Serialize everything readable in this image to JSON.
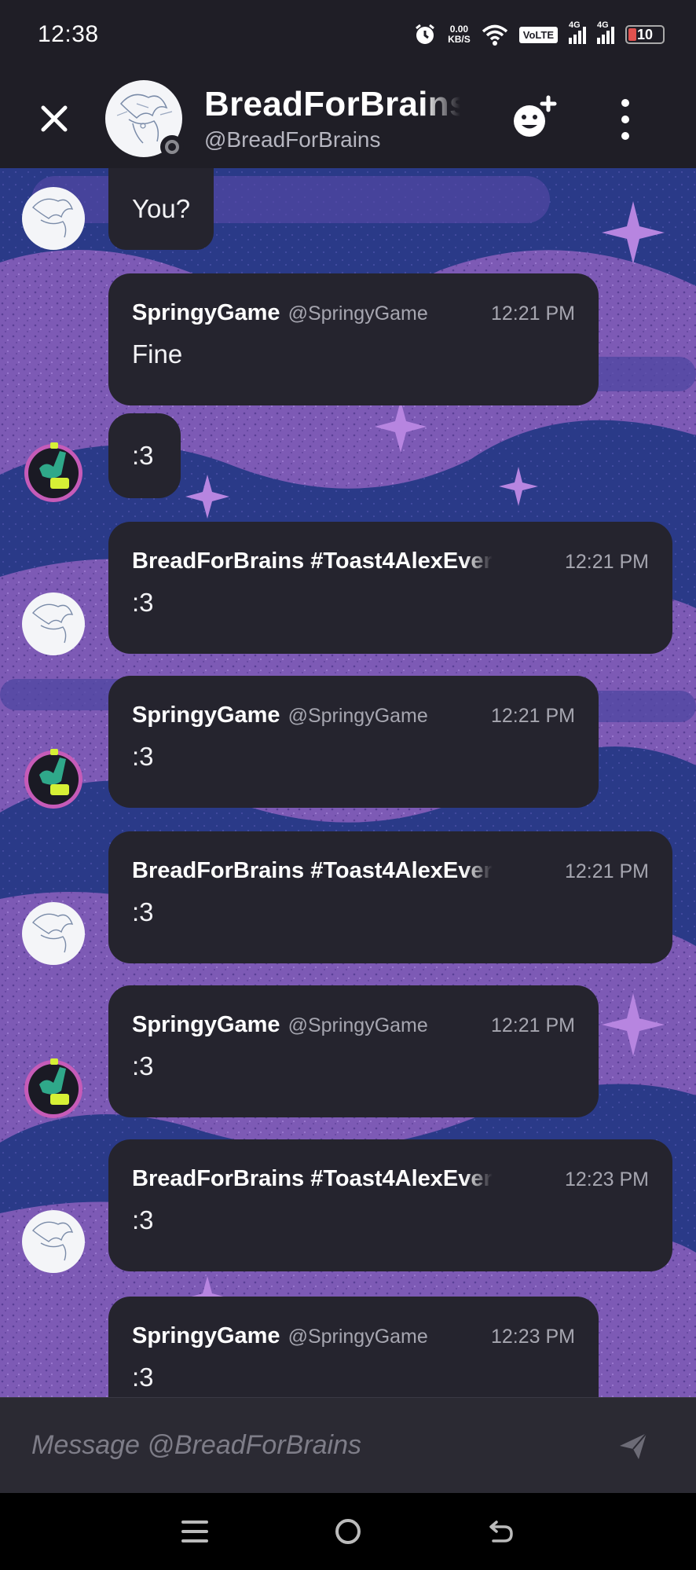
{
  "status_bar": {
    "time": "12:38",
    "net_speed_value": "0.00",
    "net_speed_unit": "KB/S",
    "volte": "VoLTE",
    "sim1_label": "4G",
    "sim2_label": "4G",
    "battery": "10"
  },
  "header": {
    "name": "BreadForBrains",
    "handle": "@BreadForBrains"
  },
  "messages": [
    {
      "author": "",
      "handle": "",
      "time": "",
      "content": "You?",
      "avatar": "sketch"
    },
    {
      "author": "SpringyGame",
      "handle": "@SpringyGame",
      "time": "12:21 PM",
      "content": "Fine",
      "avatar": "springy"
    },
    {
      "author": "",
      "handle": "",
      "time": "",
      "content": ":3",
      "avatar": "springy"
    },
    {
      "author": "BreadForBrains #Toast4AlexEver",
      "handle": "",
      "time": "12:21 PM",
      "content": ":3",
      "avatar": "sketch"
    },
    {
      "author": "SpringyGame",
      "handle": "@SpringyGame",
      "time": "12:21 PM",
      "content": ":3",
      "avatar": "springy"
    },
    {
      "author": "BreadForBrains #Toast4AlexEver",
      "handle": "",
      "time": "12:21 PM",
      "content": ":3",
      "avatar": "sketch"
    },
    {
      "author": "SpringyGame",
      "handle": "@SpringyGame",
      "time": "12:21 PM",
      "content": ":3",
      "avatar": "springy"
    },
    {
      "author": "BreadForBrains #Toast4AlexEver",
      "handle": "",
      "time": "12:23 PM",
      "content": ":3",
      "avatar": "sketch"
    },
    {
      "author": "SpringyGame",
      "handle": "@SpringyGame",
      "time": "12:23 PM",
      "content": ":3",
      "avatar": "springy"
    }
  ],
  "input": {
    "placeholder": "Message @BreadForBrains"
  },
  "colors": {
    "background": "#1f1e26",
    "bubble": "#25242e",
    "chat_bg_dark": "#2a3a88",
    "chat_bg_purple": "#7d5ab5",
    "muted_text": "#a6a6b0"
  },
  "icons": [
    "close-icon",
    "add-friend-icon",
    "more-vert-icon",
    "send-icon",
    "nav-menu-icon",
    "nav-home-icon",
    "nav-back-icon",
    "alarm-icon",
    "wifi-icon"
  ]
}
